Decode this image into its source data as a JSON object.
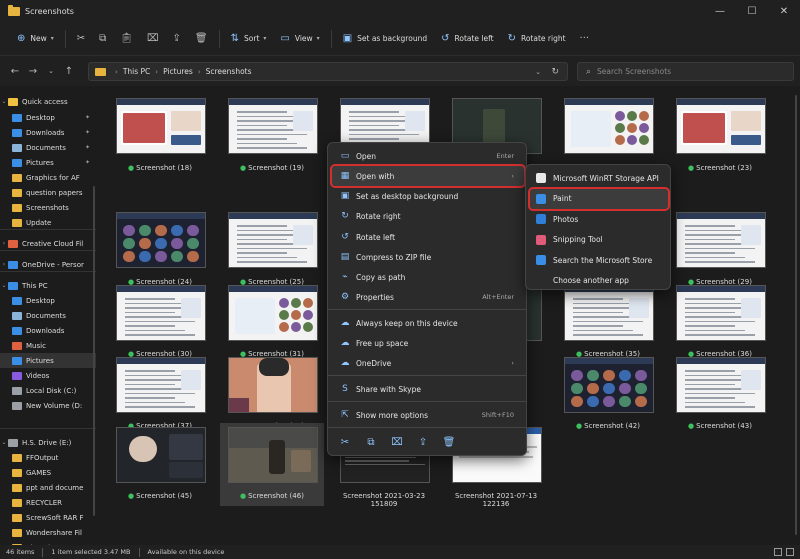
{
  "window": {
    "title": "Screenshots",
    "controls": [
      "—",
      "☐",
      "✕"
    ]
  },
  "toolbar": {
    "new_label": "New",
    "sort_label": "Sort",
    "view_label": "View",
    "set_bg_label": "Set as background",
    "rotate_left_label": "Rotate left",
    "rotate_right_label": "Rotate right",
    "more_label": "···"
  },
  "address": {
    "crumbs": [
      "This PC",
      "Pictures",
      "Screenshots"
    ],
    "search_placeholder": "Search Screenshots"
  },
  "sidebar": {
    "items": [
      {
        "label": "Quick access",
        "icon": "star-icon",
        "color": "#f0c040",
        "pinned": false,
        "chev": "⌄"
      },
      {
        "label": "Desktop",
        "icon": "desktop-icon",
        "color": "#3a8ee6",
        "pinned": true
      },
      {
        "label": "Downloads",
        "icon": "download-icon",
        "color": "#3a8ee6",
        "pinned": true
      },
      {
        "label": "Documents",
        "icon": "document-icon",
        "color": "#8ab4d8",
        "pinned": true
      },
      {
        "label": "Pictures",
        "icon": "picture-icon",
        "color": "#3a8ee6",
        "pinned": true
      },
      {
        "label": "Graphics for AF",
        "icon": "folder-icon",
        "color": "#e8b440",
        "pinned": false
      },
      {
        "label": "question papers",
        "icon": "folder-icon",
        "color": "#e8b440",
        "pinned": false
      },
      {
        "label": "Screenshots",
        "icon": "folder-icon",
        "color": "#e8b440",
        "pinned": false
      },
      {
        "label": "Update",
        "icon": "folder-icon",
        "color": "#e8b440",
        "pinned": false
      },
      {
        "label": "Creative Cloud Fil",
        "icon": "cloud-icon",
        "color": "#e06040",
        "pinned": false,
        "chev": "›"
      },
      {
        "label": "OneDrive - Persor",
        "icon": "onedrive-icon",
        "color": "#3a8ee6",
        "pinned": false,
        "chev": "›"
      },
      {
        "label": "This PC",
        "icon": "pc-icon",
        "color": "#3a8ee6",
        "pinned": false,
        "chev": "⌄"
      },
      {
        "label": "Desktop",
        "icon": "desktop-icon",
        "color": "#3a8ee6",
        "pinned": false
      },
      {
        "label": "Documents",
        "icon": "document-icon",
        "color": "#8ab4d8",
        "pinned": false
      },
      {
        "label": "Downloads",
        "icon": "download-icon",
        "color": "#3a8ee6",
        "pinned": false
      },
      {
        "label": "Music",
        "icon": "music-icon",
        "color": "#e06040",
        "pinned": false
      },
      {
        "label": "Pictures",
        "icon": "picture-icon",
        "color": "#3a8ee6",
        "pinned": false,
        "selected": true
      },
      {
        "label": "Videos",
        "icon": "video-icon",
        "color": "#8a5ae0",
        "pinned": false
      },
      {
        "label": "Local Disk (C:)",
        "icon": "drive-icon",
        "color": "#9aa0a6",
        "pinned": false
      },
      {
        "label": "New Volume (D:",
        "icon": "drive-icon",
        "color": "#9aa0a6",
        "pinned": false
      },
      {
        "label": "H.S. Drive (E:)",
        "icon": "drive-icon",
        "color": "#9aa0a6",
        "pinned": false
      },
      {
        "label": "H.S. Drive (E:)",
        "icon": "drive-icon",
        "color": "#9aa0a6",
        "pinned": false,
        "chev": "⌄"
      },
      {
        "label": "FFOutput",
        "icon": "folder-icon",
        "color": "#e8b440",
        "pinned": false
      },
      {
        "label": "GAMES",
        "icon": "folder-icon",
        "color": "#e8b440",
        "pinned": false
      },
      {
        "label": "ppt and docume",
        "icon": "folder-icon",
        "color": "#e8b440",
        "pinned": false
      },
      {
        "label": "RECYCLER",
        "icon": "folder-icon",
        "color": "#e8b440",
        "pinned": false
      },
      {
        "label": "ScrewSoft RAR F",
        "icon": "folder-icon",
        "color": "#e8b440",
        "pinned": false
      },
      {
        "label": "Wondershare Fil",
        "icon": "folder-icon",
        "color": "#e8b440",
        "pinned": false
      },
      {
        "label": "Xiaomi",
        "icon": "folder-icon",
        "color": "#e8b440",
        "pinned": false
      }
    ]
  },
  "files": [
    {
      "label": "Screenshot (18)",
      "style": "ppt"
    },
    {
      "label": "Screenshot (19)",
      "style": "doc"
    },
    {
      "label": "",
      "style": "doc"
    },
    {
      "label": "",
      "style": "dark"
    },
    {
      "label": "Screenshot (22)",
      "style": "meet"
    },
    {
      "label": "Screenshot (23)",
      "style": "ppt"
    },
    {
      "label": "Screenshot (24)",
      "style": "meetdark"
    },
    {
      "label": "Screenshot (25)",
      "style": "doc"
    },
    {
      "label": "",
      "style": "blank"
    },
    {
      "label": "",
      "style": "blank"
    },
    {
      "label": "",
      "style": "doc"
    },
    {
      "label": "Screenshot (29)",
      "style": "doc"
    },
    {
      "label": "Screenshot (30)",
      "style": "doc"
    },
    {
      "label": "Screenshot (31)",
      "style": "meet"
    },
    {
      "label": "",
      "style": "blank"
    },
    {
      "label": "",
      "style": "dark"
    },
    {
      "label": "Screenshot (35)",
      "style": "doc"
    },
    {
      "label": "Screenshot (36)",
      "style": "doc"
    },
    {
      "label": "Screenshot (37)",
      "style": "doc"
    },
    {
      "label": "Screenshot (38)",
      "style": "art"
    },
    {
      "label": "",
      "style": "blank"
    },
    {
      "label": "",
      "style": "blank"
    },
    {
      "label": "Screenshot (42)",
      "style": "meetdark"
    },
    {
      "label": "Screenshot (43)",
      "style": "doc"
    },
    {
      "label": "Screenshot (45)",
      "style": "call"
    },
    {
      "label": "Screenshot (46)",
      "style": "game"
    },
    {
      "label": "Screenshot 2021-03-23\n151809",
      "style": "terminal"
    },
    {
      "label": "Screenshot 2021-07-13\n122136",
      "style": "web"
    }
  ],
  "context_menu": {
    "items": [
      {
        "label": "Open",
        "icon": "open-icon",
        "shortcut": "Enter"
      },
      {
        "label": "Open with",
        "icon": "open-with-icon",
        "shortcut": "›",
        "highlight": true
      },
      {
        "label": "Set as desktop background",
        "icon": "wallpaper-icon",
        "shortcut": ""
      },
      {
        "label": "Rotate right",
        "icon": "rotate-right-icon",
        "shortcut": ""
      },
      {
        "label": "Rotate left",
        "icon": "rotate-left-icon",
        "shortcut": ""
      },
      {
        "label": "Compress to ZIP file",
        "icon": "zip-icon",
        "shortcut": ""
      },
      {
        "label": "Copy as path",
        "icon": "path-icon",
        "shortcut": ""
      },
      {
        "label": "Properties",
        "icon": "properties-icon",
        "shortcut": "Alt+Enter"
      },
      {
        "label": "Always keep on this device",
        "icon": "cloud-keep-icon",
        "shortcut": ""
      },
      {
        "label": "Free up space",
        "icon": "cloud-free-icon",
        "shortcut": ""
      },
      {
        "label": "OneDrive",
        "icon": "onedrive-icon",
        "shortcut": "›"
      },
      {
        "label": "Share with Skype",
        "icon": "skype-icon",
        "shortcut": ""
      },
      {
        "label": "Show more options",
        "icon": "more-options-icon",
        "shortcut": "Shift+F10"
      }
    ]
  },
  "submenu": {
    "items": [
      {
        "label": "Microsoft WinRT Storage API",
        "icon": "file-icon",
        "color": "#e8e8e8"
      },
      {
        "label": "Paint",
        "icon": "paint-icon",
        "color": "#3a8ee6",
        "highlight": true
      },
      {
        "label": "Photos",
        "icon": "photos-icon",
        "color": "#2f7fd8"
      },
      {
        "label": "Snipping Tool",
        "icon": "snip-icon",
        "color": "#e05a7a"
      },
      {
        "label": "Search the Microsoft Store",
        "icon": "store-icon",
        "color": "#3a8ee6"
      },
      {
        "label": "Choose another app",
        "icon": "",
        "color": ""
      }
    ]
  },
  "status": {
    "items_count": "46 items",
    "selected": "1 item selected  3.47 MB",
    "availability": "Available on this device"
  }
}
